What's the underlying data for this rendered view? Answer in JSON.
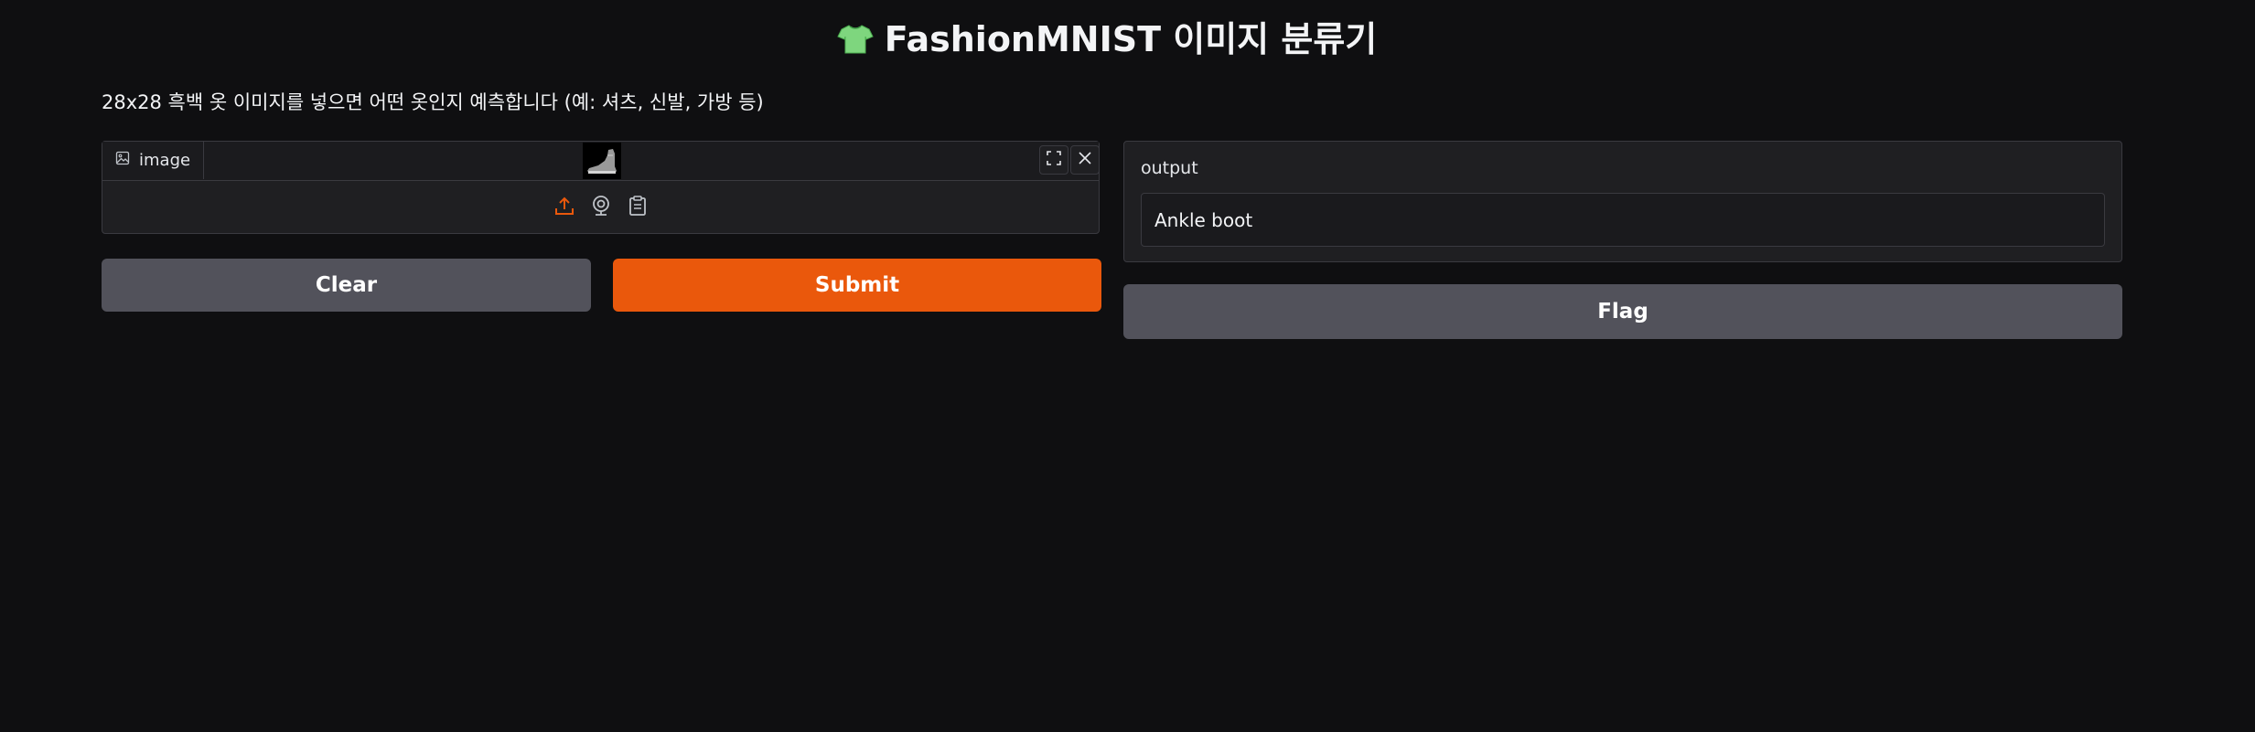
{
  "app": {
    "title": "FashionMNIST 이미지 분류기",
    "title_icon": "t-shirt-icon",
    "description": "28x28 흑백 옷 이미지를 넣으면 어떤 옷인지 예측합니다 (예: 셔츠, 신발, 가방 등)"
  },
  "image_input": {
    "label": "image",
    "label_icon": "image-icon",
    "header_buttons": [
      "fullscreen-icon",
      "close-icon"
    ],
    "source_buttons": [
      "upload-icon",
      "webcam-icon",
      "clipboard-icon"
    ]
  },
  "buttons": {
    "clear": "Clear",
    "submit": "Submit",
    "flag": "Flag"
  },
  "output": {
    "label": "output",
    "value": "Ankle boot"
  },
  "colors": {
    "background": "#0f0f11",
    "panel": "#1f1f22",
    "border": "#3a3a40",
    "primary": "#ea580c",
    "secondary": "#52525b",
    "shirt_green": "#7ed67e"
  }
}
